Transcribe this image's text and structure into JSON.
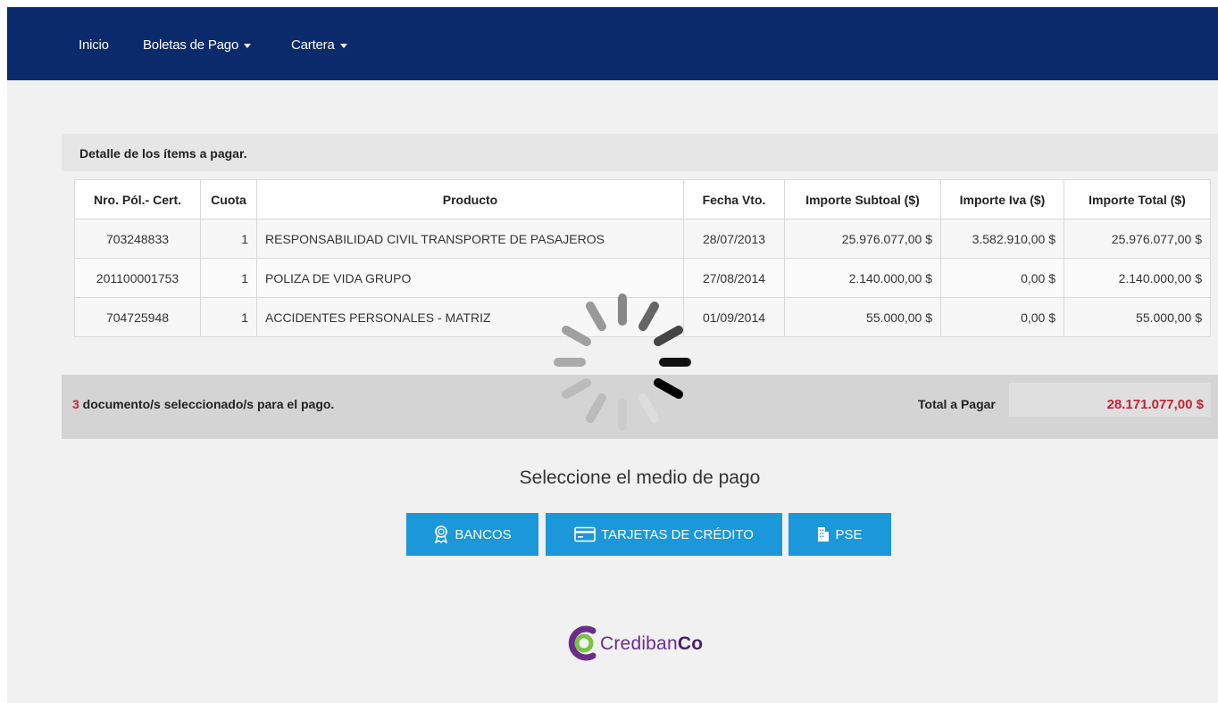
{
  "nav": {
    "items": [
      {
        "label": "Inicio",
        "dropdown": false
      },
      {
        "label": "Boletas de Pago",
        "dropdown": true
      },
      {
        "label": "Cartera",
        "dropdown": true
      }
    ]
  },
  "panel": {
    "title": "Detalle de los ítems a pagar."
  },
  "table": {
    "headers": [
      "Nro. Pól.- Cert.",
      "Cuota",
      "Producto",
      "Fecha Vto.",
      "Importe Subtoal ($)",
      "Importe Iva ($)",
      "Importe Total ($)"
    ],
    "rows": [
      [
        "703248833",
        "1",
        "RESPONSABILIDAD CIVIL TRANSPORTE DE PASAJEROS",
        "28/07/2013",
        "25.976.077,00 $",
        "3.582.910,00 $",
        "25.976.077,00 $"
      ],
      [
        "201100001753",
        "1",
        "POLIZA DE VIDA GRUPO",
        "27/08/2014",
        "2.140.000,00 $",
        "0,00 $",
        "2.140.000,00 $"
      ],
      [
        "704725948",
        "1",
        "ACCIDENTES PERSONALES - MATRIZ",
        "01/09/2014",
        "55.000,00 $",
        "0,00 $",
        "55.000,00 $"
      ]
    ]
  },
  "summary": {
    "count": "3",
    "text": " documento/s seleccionado/s para el pago.",
    "total_label": "Total a Pagar",
    "total_value": "28.171.077,00 $"
  },
  "payment": {
    "title": "Seleccione el medio de pago",
    "buttons": [
      {
        "label": "BANCOS",
        "icon": "award-icon"
      },
      {
        "label": "TARJETAS DE CRÉDITO",
        "icon": "credit-card-icon"
      },
      {
        "label": "PSE",
        "icon": "building-icon"
      }
    ]
  },
  "logo": {
    "text_light": "Crediban",
    "text_bold": "Co"
  },
  "colors": {
    "navbar": "#0b2a6b",
    "button": "#1b98d9",
    "total": "#c52136",
    "logo_purple": "#6b2d8d",
    "logo_green": "#7ac142"
  }
}
